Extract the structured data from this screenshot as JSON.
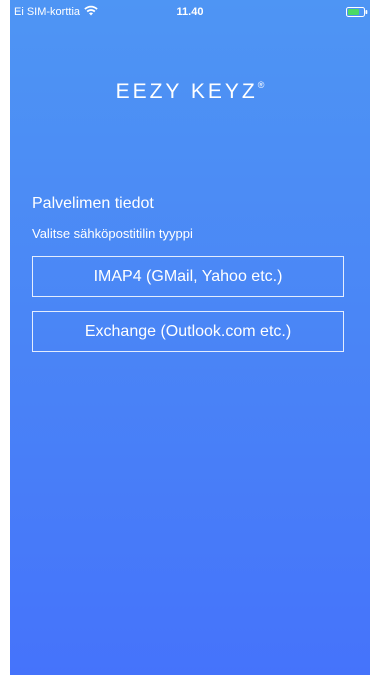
{
  "status_bar": {
    "carrier": "Ei SIM-korttia",
    "time": "11.40",
    "wifi_icon": "wifi-icon",
    "battery_icon": "battery-icon",
    "battery_color": "#4cd964"
  },
  "logo": {
    "text": "EEZY KEYZ",
    "mark": "®"
  },
  "server_info": {
    "title": "Palvelimen tiedot",
    "subtitle": "Valitse sähköpostitilin tyyppi"
  },
  "options": {
    "imap_label": "IMAP4 (GMail, Yahoo etc.)",
    "exchange_label": "Exchange (Outlook.com etc.)"
  },
  "colors": {
    "gradient_top": "#4e95f4",
    "gradient_bottom": "#4573fb",
    "text": "#ffffff"
  }
}
